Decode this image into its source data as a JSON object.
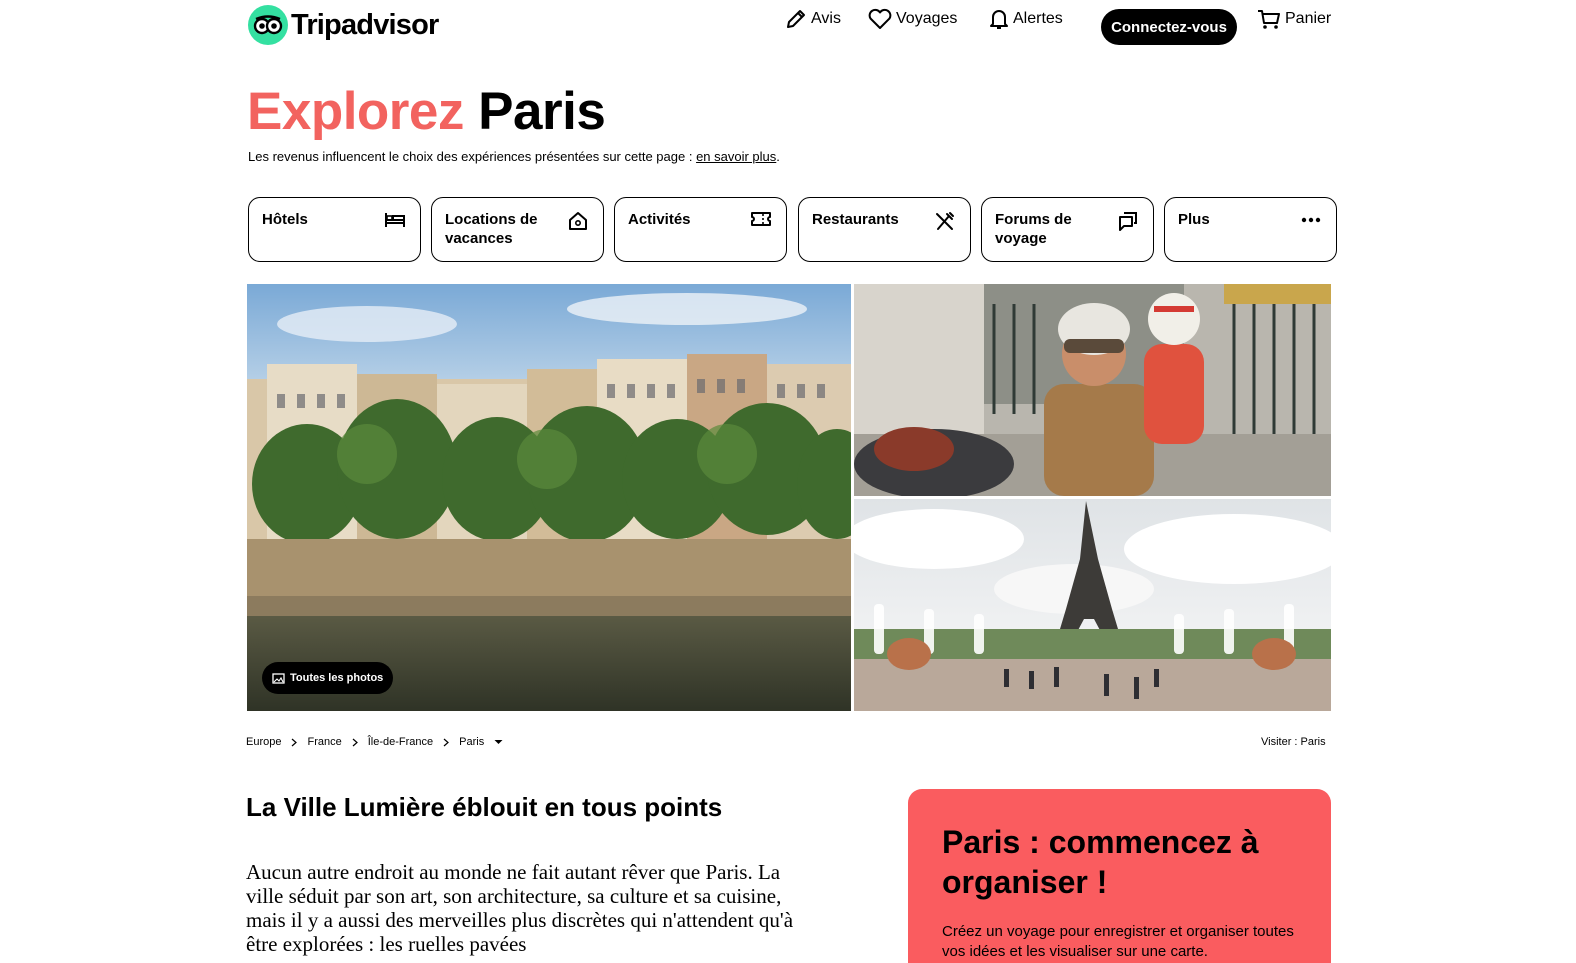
{
  "header": {
    "logo_text": "Tripadvisor",
    "nav": {
      "reviews": "Avis",
      "trips": "Voyages",
      "alerts": "Alertes",
      "login": "Connectez-vous",
      "cart": "Panier"
    }
  },
  "hero": {
    "title_accent": "Explorez",
    "title_city": "Paris",
    "disclaimer": "Les revenus influencent le choix des expériences présentées sur cette page : ",
    "disclaimer_link": "en savoir plus",
    "disclaimer_end": "."
  },
  "categories": [
    {
      "label": "Hôtels",
      "icon": "bed-icon"
    },
    {
      "label": "Locations de vacances",
      "icon": "house-key-icon"
    },
    {
      "label": "Activités",
      "icon": "ticket-icon"
    },
    {
      "label": "Restaurants",
      "icon": "utensils-icon"
    },
    {
      "label": "Forums de voyage",
      "icon": "chat-icon"
    },
    {
      "label": "Plus",
      "icon": "more-icon"
    }
  ],
  "photos": {
    "all_photos_label": "Toutes les photos"
  },
  "breadcrumb": {
    "items": [
      "Europe",
      "France",
      "Île-de-France",
      "Paris"
    ],
    "visit_label": "Visiter : Paris"
  },
  "content": {
    "section_title": "La Ville Lumière éblouit en tous points",
    "intro": "Aucun autre endroit au monde ne fait autant rêver que Paris. La ville séduit par son art, son architecture, sa culture et sa cuisine, mais il y a aussi des merveilles plus discrètes qui n'attendent qu'à être explorées : les ruelles pavées"
  },
  "plan_card": {
    "title": "Paris : commencez à organiser !",
    "text": "Créez un voyage pour enregistrer et organiser toutes vos idées et les visualiser sur une carte."
  },
  "colors": {
    "brand_green": "#34e0a1",
    "accent_red": "#f2635f",
    "card_red": "#fa5c5f"
  }
}
